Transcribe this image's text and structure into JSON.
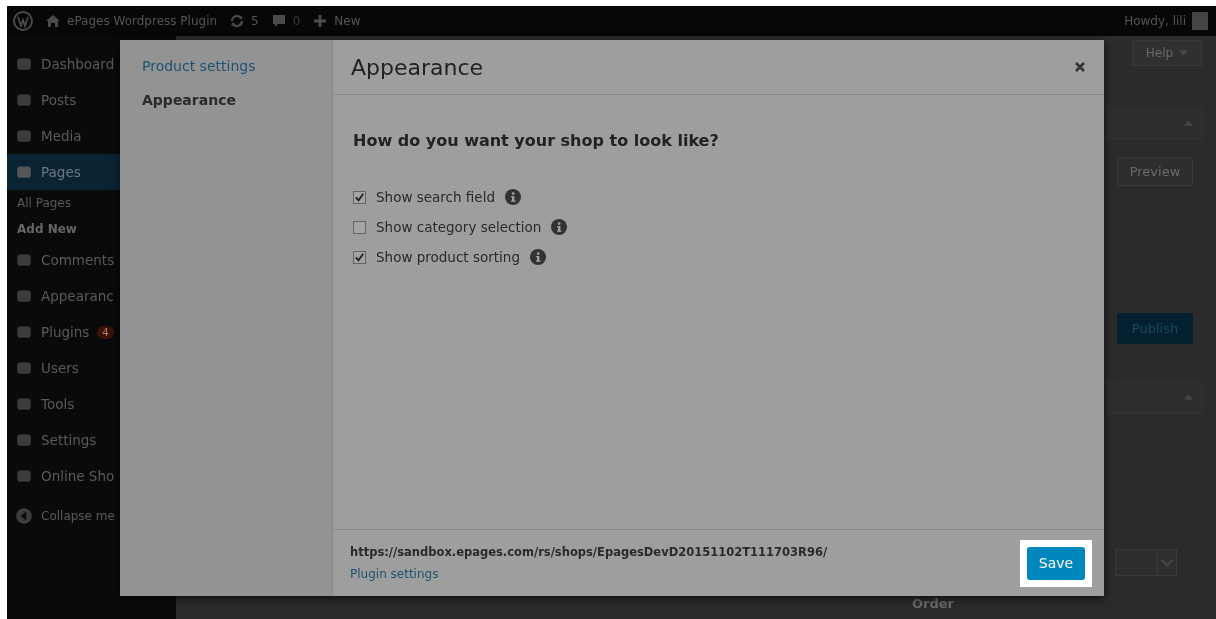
{
  "admin_bar": {
    "site_title": "ePages Wordpress Plugin",
    "updates_count": "5",
    "comments_count": "0",
    "new_label": "New",
    "greeting": "Howdy, lili"
  },
  "sidebar": {
    "items": [
      {
        "kind": "menu",
        "label": "Dashboard",
        "selected": false
      },
      {
        "kind": "menu",
        "label": "Posts",
        "selected": false
      },
      {
        "kind": "menu",
        "label": "Media",
        "selected": false
      },
      {
        "kind": "menu",
        "label": "Pages",
        "selected": true
      },
      {
        "kind": "sub",
        "label": "All Pages",
        "selected": false
      },
      {
        "kind": "sub",
        "label": "Add New",
        "selected": true
      },
      {
        "kind": "menu",
        "label": "Comments",
        "selected": false
      },
      {
        "kind": "menu",
        "label": "Appearanc",
        "selected": false
      },
      {
        "kind": "menu",
        "label": "Plugins",
        "badge": "4",
        "selected": false
      },
      {
        "kind": "menu",
        "label": "Users",
        "selected": false
      },
      {
        "kind": "menu",
        "label": "Tools",
        "selected": false
      },
      {
        "kind": "menu",
        "label": "Settings",
        "selected": false
      },
      {
        "kind": "menu",
        "label": "Online Sho",
        "selected": false
      },
      {
        "kind": "collapse",
        "label": "Collapse me",
        "selected": false
      }
    ]
  },
  "background": {
    "help_tab": "Help",
    "preview_button": "Preview",
    "publish_button": "Publish",
    "order_label": "Order"
  },
  "modal": {
    "nav": [
      {
        "label": "Product settings",
        "selected": false
      },
      {
        "label": "Appearance",
        "selected": true
      }
    ],
    "title": "Appearance",
    "question": "How do you want your shop to look like?",
    "options": [
      {
        "label": "Show search field",
        "checked": true
      },
      {
        "label": "Show category selection",
        "checked": false
      },
      {
        "label": "Show product sorting",
        "checked": true
      }
    ],
    "shop_url": "https://sandbox.epages.com/rs/shops/EpagesDevD20151102T111703R96/",
    "settings_link": "Plugin settings",
    "save_button": "Save"
  }
}
